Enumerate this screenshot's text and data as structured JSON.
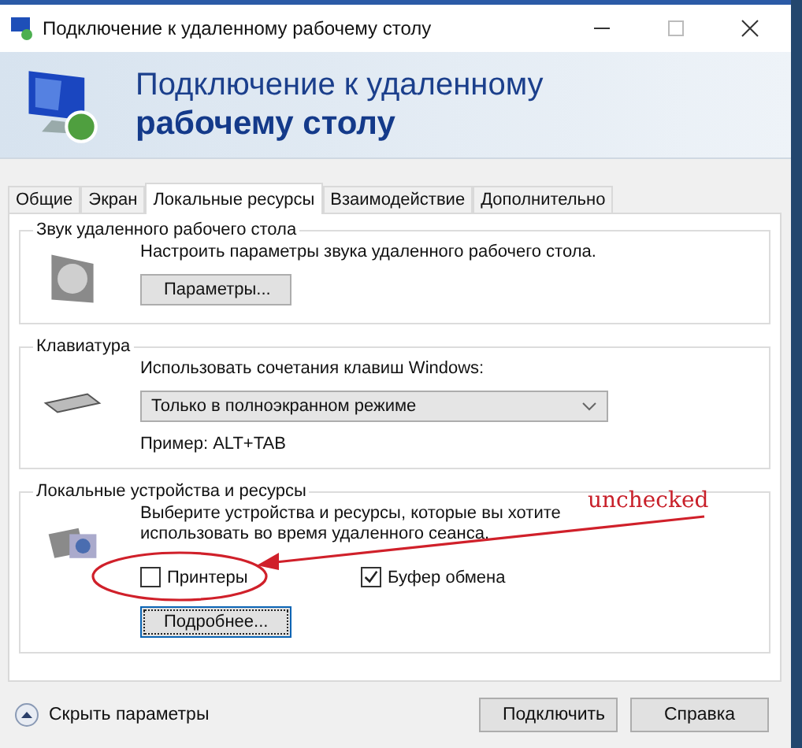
{
  "window": {
    "title": "Подключение к удаленному рабочему столу"
  },
  "header": {
    "line_1": "Подключение к удаленному",
    "line_2": "рабочему столу"
  },
  "tabs": [
    {
      "label": "Общие",
      "selected": false
    },
    {
      "label": "Экран",
      "selected": false
    },
    {
      "label": "Локальные ресурсы",
      "selected": true
    },
    {
      "label": "Взаимодействие",
      "selected": false
    },
    {
      "label": "Дополнительно",
      "selected": false
    }
  ],
  "sound": {
    "legend": "Звук удаленного рабочего стола",
    "text": "Настроить параметры звука удаленного рабочего стола.",
    "button": "Параметры..."
  },
  "keyboard": {
    "legend": "Клавиатура",
    "text": "Использовать сочетания клавиш Windows:",
    "dropdown": "Только в полноэкранном режиме",
    "example": "Пример: ALT+TAB"
  },
  "local": {
    "legend": "Локальные устройства и ресурсы",
    "text": "Выберите устройства и ресурсы, которые вы хотите использовать во время удаленного сеанса.",
    "checkboxes": [
      {
        "label": "Принтеры",
        "checked": false
      },
      {
        "label": "Буфер обмена",
        "checked": true
      }
    ],
    "button": "Подробнее..."
  },
  "footer": {
    "toggle": "Скрыть параметры",
    "buttons": [
      "Подключить",
      "Справка"
    ]
  },
  "annotation": {
    "text": "unchecked"
  }
}
